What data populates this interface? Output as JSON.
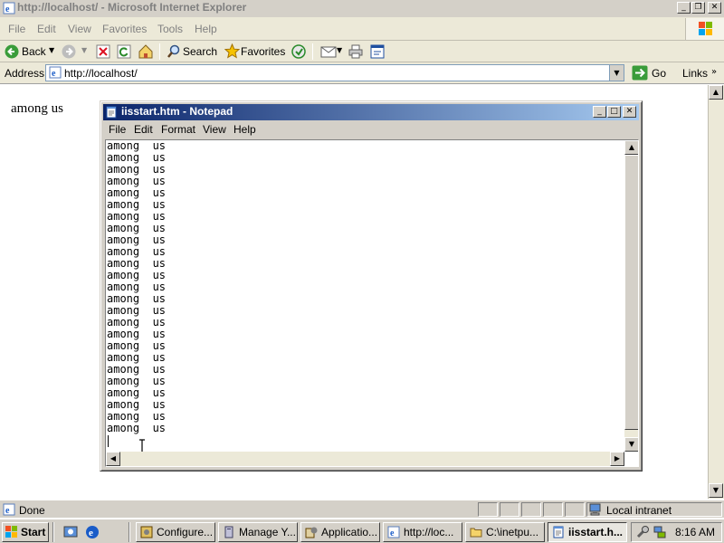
{
  "browser": {
    "title": "http://localhost/ - Microsoft Internet Explorer",
    "menu": [
      "File",
      "Edit",
      "View",
      "Favorites",
      "Tools",
      "Help"
    ],
    "toolbar": {
      "back": "Back",
      "search": "Search",
      "favorites": "Favorites"
    },
    "address": {
      "label": "Address",
      "url": "http://localhost/",
      "go": "Go",
      "links": "Links"
    },
    "page_text": "among us",
    "status": {
      "text": "Done",
      "zone": "Local intranet"
    }
  },
  "notepad": {
    "title": "iisstart.htm - Notepad",
    "menu": [
      "File",
      "Edit",
      "Format",
      "View",
      "Help"
    ],
    "lines": [
      "among  us",
      "among  us",
      "among  us",
      "among  us",
      "among  us",
      "among  us",
      "among  us",
      "among  us",
      "among  us",
      "among  us",
      "among  us",
      "among  us",
      "among  us",
      "among  us",
      "among  us",
      "among  us",
      "among  us",
      "among  us",
      "among  us",
      "among  us",
      "among  us",
      "among  us",
      "among  us",
      "among  us",
      "among  us"
    ]
  },
  "taskbar": {
    "start": "Start",
    "items": [
      {
        "label": "Configure...",
        "icon": "gear-window-icon",
        "active": false
      },
      {
        "label": "Manage Y...",
        "icon": "server-icon",
        "active": false
      },
      {
        "label": "Applicatio...",
        "icon": "app-server-icon",
        "active": false
      },
      {
        "label": "http://loc...",
        "icon": "ie-icon",
        "active": false
      },
      {
        "label": "C:\\inetpu...",
        "icon": "folder-icon",
        "active": false
      },
      {
        "label": "iisstart.h...",
        "icon": "notepad-icon",
        "active": true
      }
    ],
    "clock": "8:16 AM"
  },
  "colors": {
    "active_title_start": "#0a246a",
    "active_title_end": "#a6caf0",
    "face": "#d4d0c8",
    "xp_face": "#ece9d8"
  }
}
